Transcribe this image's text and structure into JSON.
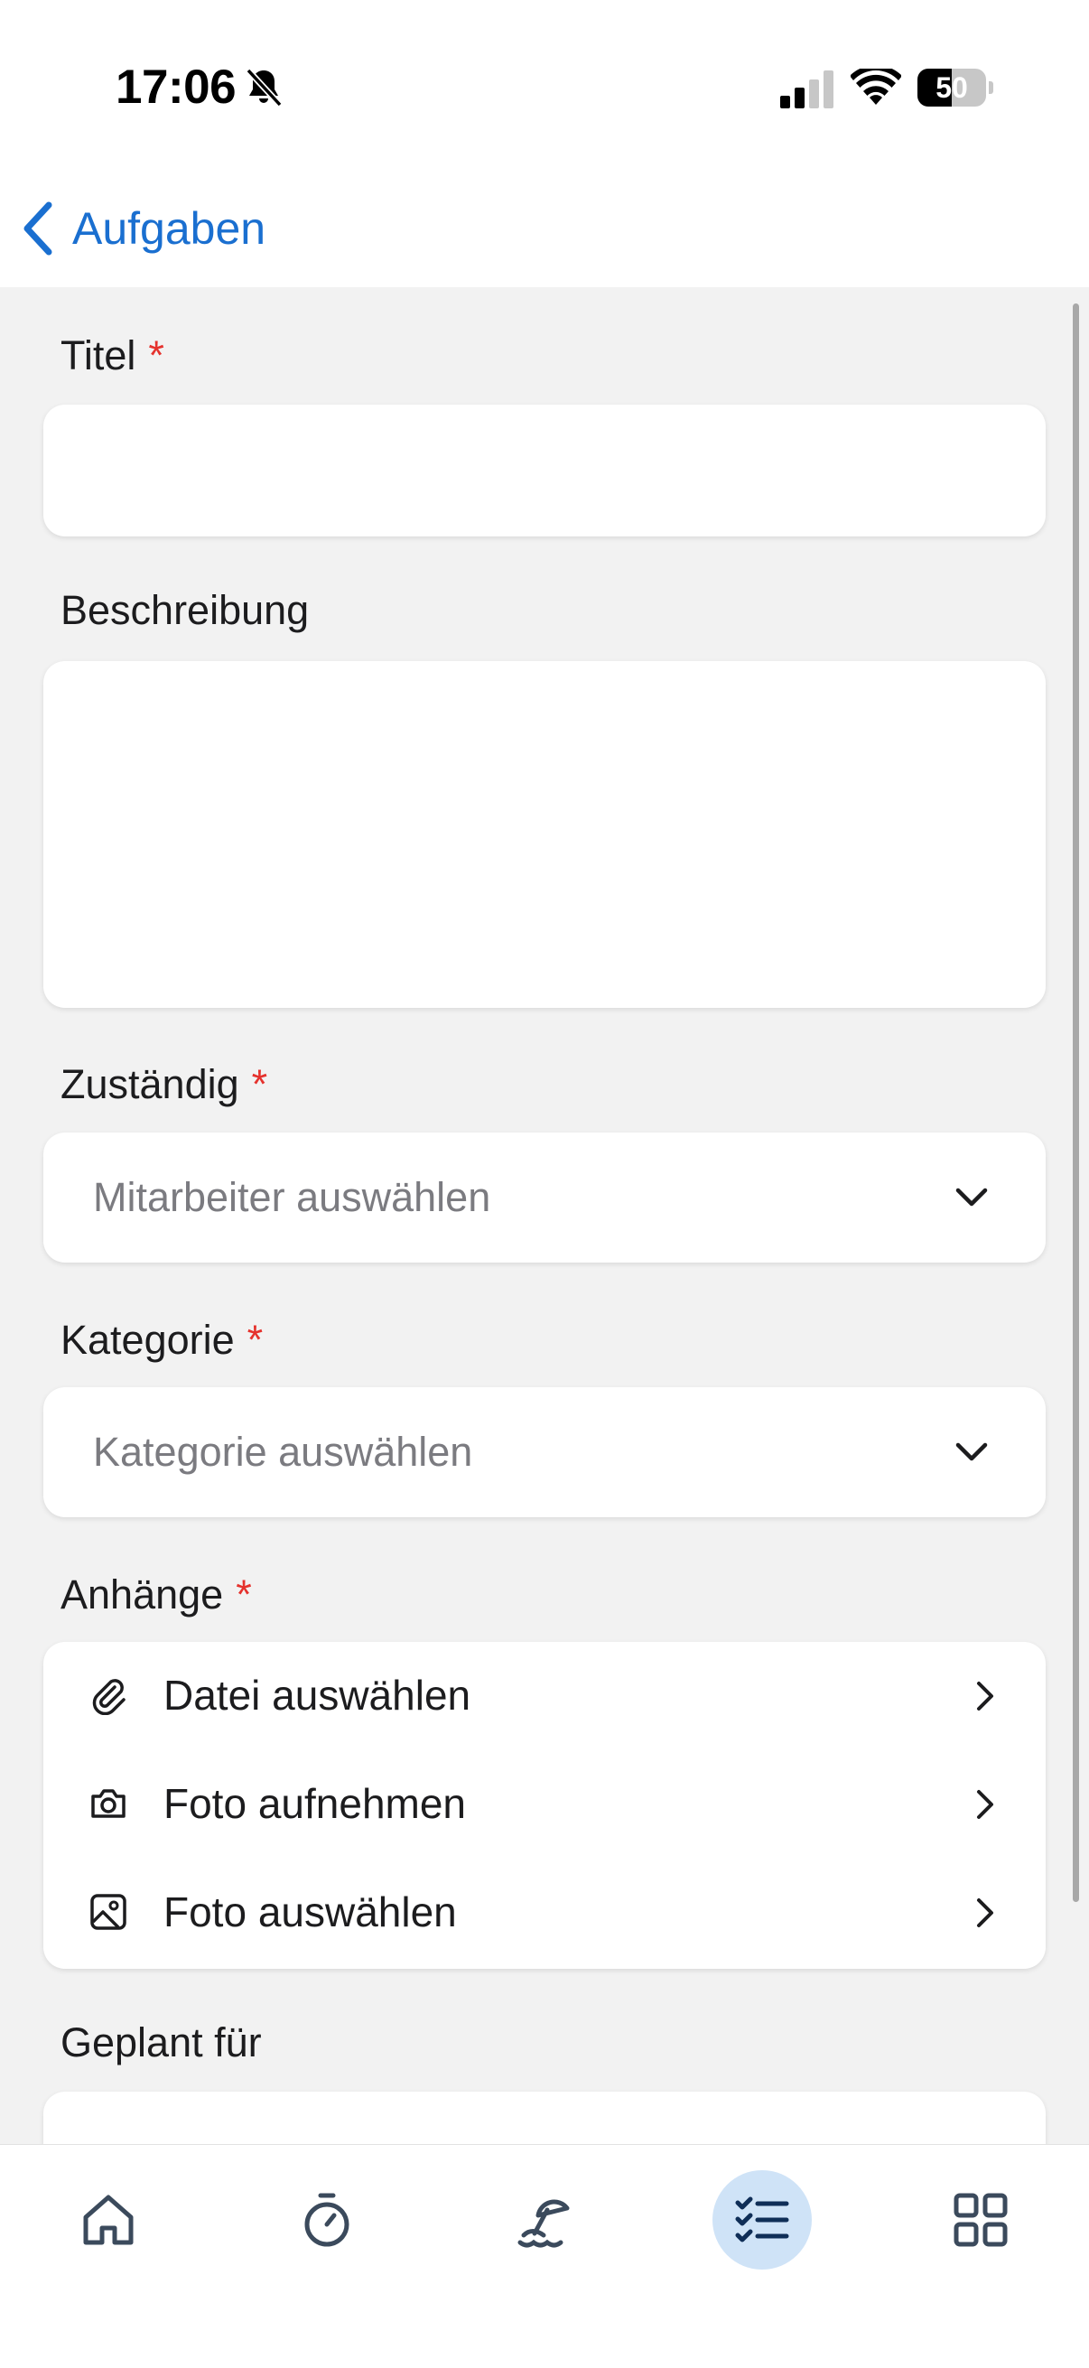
{
  "status_bar": {
    "time": "17:06",
    "battery_level": "50",
    "battery_fraction": 0.5,
    "silent_mode": true
  },
  "nav": {
    "back_label": "Aufgaben"
  },
  "form": {
    "title": {
      "label": "Titel",
      "required_mark": "*",
      "value": ""
    },
    "description": {
      "label": "Beschreibung",
      "value": ""
    },
    "assignee": {
      "label": "Zuständig",
      "required_mark": "*",
      "placeholder": "Mitarbeiter auswählen"
    },
    "category": {
      "label": "Kategorie",
      "required_mark": "*",
      "placeholder": "Kategorie auswählen"
    },
    "attachments": {
      "label": "Anhänge",
      "required_mark": "*",
      "options": [
        {
          "label": "Datei auswählen",
          "icon": "paperclip-icon"
        },
        {
          "label": "Foto aufnehmen",
          "icon": "camera-icon"
        },
        {
          "label": "Foto auswählen",
          "icon": "image-icon"
        }
      ]
    },
    "planned_for": {
      "label": "Geplant für"
    }
  },
  "tab_bar": {
    "tabs": [
      {
        "icon": "home-icon",
        "active": false
      },
      {
        "icon": "stopwatch-icon",
        "active": false
      },
      {
        "icon": "beach-umbrella-icon",
        "active": false
      },
      {
        "icon": "checklist-icon",
        "active": true
      },
      {
        "icon": "grid-icon",
        "active": false
      }
    ]
  },
  "colors": {
    "accent": "#1a6fd0",
    "required": "#e5322d",
    "background": "#f2f2f2",
    "card": "#ffffff",
    "active_tab_bg": "#cfe3f7",
    "icon": "#3b4a5c"
  }
}
